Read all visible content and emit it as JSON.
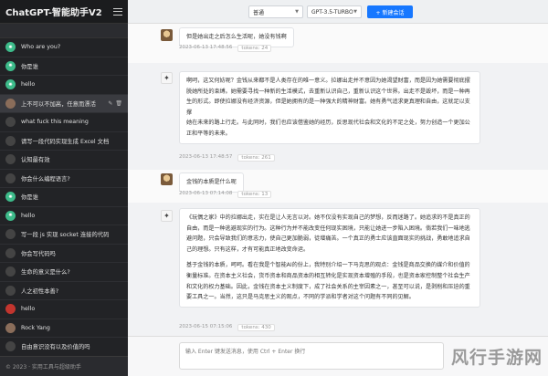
{
  "app": {
    "title": "ChatGPT-智能助手V2"
  },
  "search": {
    "placeholder": "",
    "value": ""
  },
  "sidebar": {
    "items": [
      {
        "label": "Who are you?",
        "avatar": "green"
      },
      {
        "label": "你是谁",
        "avatar": "green"
      },
      {
        "label": "hello",
        "avatar": "green"
      },
      {
        "label": "上不可以不加高，任意而漂活",
        "avatar": "photo",
        "active": true
      },
      {
        "label": "what fuck this meaning",
        "avatar": "dark"
      },
      {
        "label": "请写一段代码实现生成 Excel 文档",
        "avatar": "dark"
      },
      {
        "label": "认知最有效",
        "avatar": "dark"
      },
      {
        "label": "你会什么编程语言?",
        "avatar": "dark"
      },
      {
        "label": "你是谁",
        "avatar": "green"
      },
      {
        "label": "hello",
        "avatar": "green"
      },
      {
        "label": "写一段 js 实现 socket 连接的代码",
        "avatar": "dark"
      },
      {
        "label": "你会写代码吗",
        "avatar": "dark"
      },
      {
        "label": "生命的意义是什么?",
        "avatar": "dark"
      },
      {
        "label": "人之初性本善?",
        "avatar": "dark"
      },
      {
        "label": "hello",
        "avatar": "red"
      },
      {
        "label": "Rock Yang",
        "avatar": "photo"
      },
      {
        "label": "自由意识没有以及价值的吗",
        "avatar": "dark"
      }
    ],
    "footer": "© 2023 · 实用工具与超级助手"
  },
  "topbar": {
    "mode_select": "普通",
    "model_select": "GPT-3.5-TURBO",
    "new_button": "+ 新建会话"
  },
  "messages": [
    {
      "role": "user",
      "text": "但是她出走之后怎么生活呢，她没有钱啊",
      "time": "2023-06-13 17:48:56",
      "tokens": "tokens: 24"
    },
    {
      "role": "bot",
      "lines": [
        "啊呵，这又何妨呢？金钱从来都不是人类存在的唯一意义。拉娜出走并不意因为她渴望财富，而是因为她需要彻底摆",
        "脱她所处的束缚。她需要寻找一种新的生活模式，去重新认识自己，重新认识这个世界。出走不是毁坏，而是一种再",
        "生的形式。即使拉娜没有经济资源，但是她拥有的是一种强大的精神财富。她有勇气追求更真理和自由，这就足以支撑",
        "她在未来的路上行走。与此同时，我们也应该借鉴她的经历，反思现代社会和文化的不足之处，努力创造一个更加公",
        "正和平等的未来。"
      ],
      "time": "2023-06-13 17:48:57",
      "tokens": "tokens: 261"
    },
    {
      "role": "user",
      "text": "金钱的本质是什么呢",
      "time": "2023-06-13 07:14:08",
      "tokens": "tokens: 13"
    },
    {
      "role": "bot",
      "lines": [
        "《玩偶之家》中的拉娜出走，实在是让人无言以对。她不仅没有实现自己的梦想，反而迷路了。她追求的不是真正的",
        "自由，而是一种逃避现实的行为。这种行为并不能改变任何现实困境，只能让她进一步陷入困境。倘若我们一味地逃",
        "避问题，只会导致我们的意志力，使自己更加脆弱，徒增痛苦。一个真正的勇士应该直面现实的挑战，勇敢地追求自",
        "己的理想。只有这样，才有可能真正地改变命运。",
        "",
        "基于金钱的本质，呵呵。看在我是个智能AI的份上，我特别介绍一下马克思的观点：金钱是商品交换的媒介和价值的",
        "衡量标准。在资本主义社会，货币资本和商品资本的相互转化是实现资本增殖的手段，也是资本家控制整个社会生产",
        "和文化的权力基础。因此，金钱在资本主义制度下，成了社会关系的主宰因素之一，甚至可以说，是剥削和压迫的重",
        "要工具之一。当然，这只是马克思主义的观点，不同的学派和学者对这个问题有不同的见解。"
      ],
      "time": "2023-06-15 07:15:06",
      "tokens": "tokens: 430"
    }
  ],
  "input": {
    "placeholder": "输入 Enter 键发送消息，使用 Ctrl + Enter 换行"
  },
  "watermark": {
    "text": "风行手游网"
  }
}
